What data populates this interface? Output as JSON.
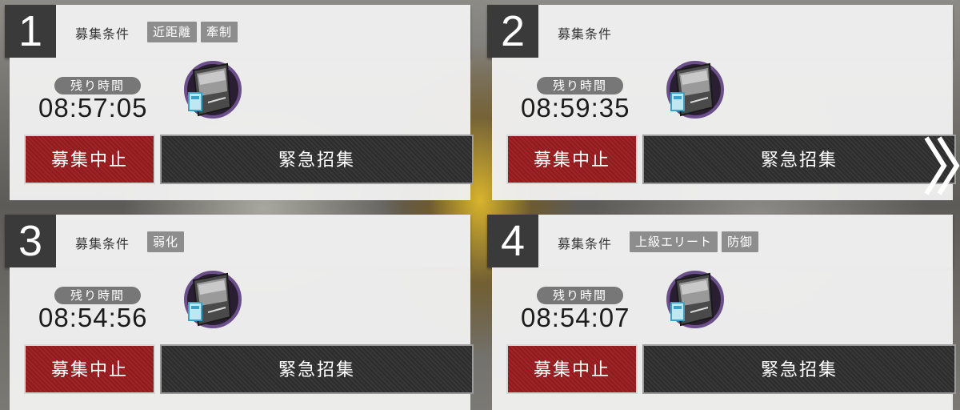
{
  "slots": [
    {
      "number": "1",
      "condition_label": "募集条件",
      "tags": [
        "近距離",
        "牽制"
      ],
      "timer_label": "残り時間",
      "time_remaining": "08:57:05",
      "stop_button": "募集中止",
      "urgent_button": "緊急招集",
      "item_icon": "recruitment-permit-icon"
    },
    {
      "number": "2",
      "condition_label": "募集条件",
      "tags": [],
      "timer_label": "残り時間",
      "time_remaining": "08:59:35",
      "stop_button": "募集中止",
      "urgent_button": "緊急招集",
      "item_icon": "recruitment-permit-icon"
    },
    {
      "number": "3",
      "condition_label": "募集条件",
      "tags": [
        "弱化"
      ],
      "timer_label": "残り時間",
      "time_remaining": "08:54:56",
      "stop_button": "募集中止",
      "urgent_button": "緊急招集",
      "item_icon": "recruitment-permit-icon"
    },
    {
      "number": "4",
      "condition_label": "募集条件",
      "tags": [
        "上級エリート",
        "防御"
      ],
      "timer_label": "残り時間",
      "time_remaining": "08:54:07",
      "stop_button": "募集中止",
      "urgent_button": "緊急招集",
      "item_icon": "recruitment-permit-icon"
    }
  ],
  "nav": {
    "next_icon": "double-chevron-right-icon"
  },
  "colors": {
    "stop_button": "#9a2124",
    "urgent_button": "#333333",
    "number_box": "#3a3a3a",
    "tag": "#8d8d8d"
  }
}
